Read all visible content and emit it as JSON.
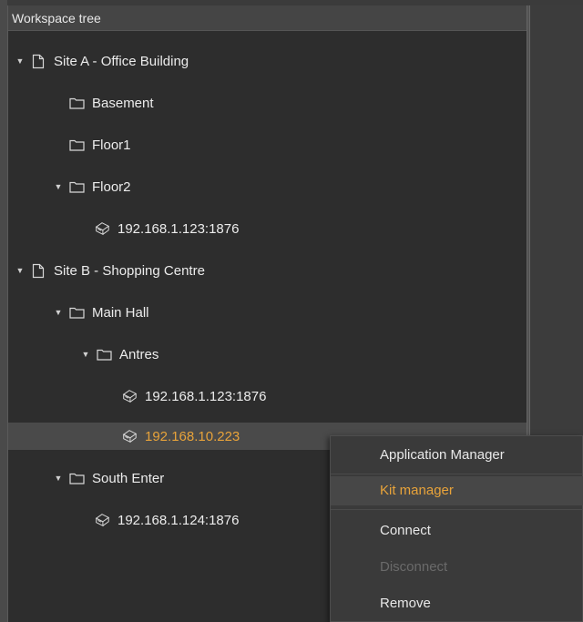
{
  "panel": {
    "title": "Workspace tree"
  },
  "tree": [
    {
      "label": "Site A - Office Building",
      "icon": "document-icon",
      "expanded": true
    },
    {
      "label": "Basement",
      "icon": "folder-icon",
      "expanded": false
    },
    {
      "label": "Floor1",
      "icon": "folder-icon",
      "expanded": false
    },
    {
      "label": "Floor2",
      "icon": "folder-icon",
      "expanded": true
    },
    {
      "label": "192.168.1.123:1876",
      "icon": "device-icon",
      "expanded": false
    },
    {
      "label": "Site B - Shopping Centre",
      "icon": "document-icon",
      "expanded": true
    },
    {
      "label": "Main Hall",
      "icon": "folder-icon",
      "expanded": true
    },
    {
      "label": "Antres",
      "icon": "folder-icon",
      "expanded": true
    },
    {
      "label": "192.168.1.123:1876",
      "icon": "device-icon",
      "expanded": false
    },
    {
      "label": "192.168.10.223",
      "icon": "device-icon",
      "expanded": false,
      "selected": true
    },
    {
      "label": "South Enter",
      "icon": "folder-icon",
      "expanded": true
    },
    {
      "label": "192.168.1.124:1876",
      "icon": "device-icon",
      "expanded": false
    }
  ],
  "context_menu": {
    "items": [
      {
        "label": "Application Manager",
        "state": "normal"
      },
      {
        "label": "Kit manager",
        "state": "highlighted"
      },
      {
        "label": "Connect",
        "state": "normal"
      },
      {
        "label": "Disconnect",
        "state": "disabled"
      },
      {
        "label": "Remove",
        "state": "normal"
      }
    ]
  },
  "colors": {
    "accent": "#e8a33a",
    "panel_bg": "#2d2d2d",
    "header_bg": "#454545",
    "text": "#ececec",
    "disabled_text": "#6a6a6a"
  }
}
